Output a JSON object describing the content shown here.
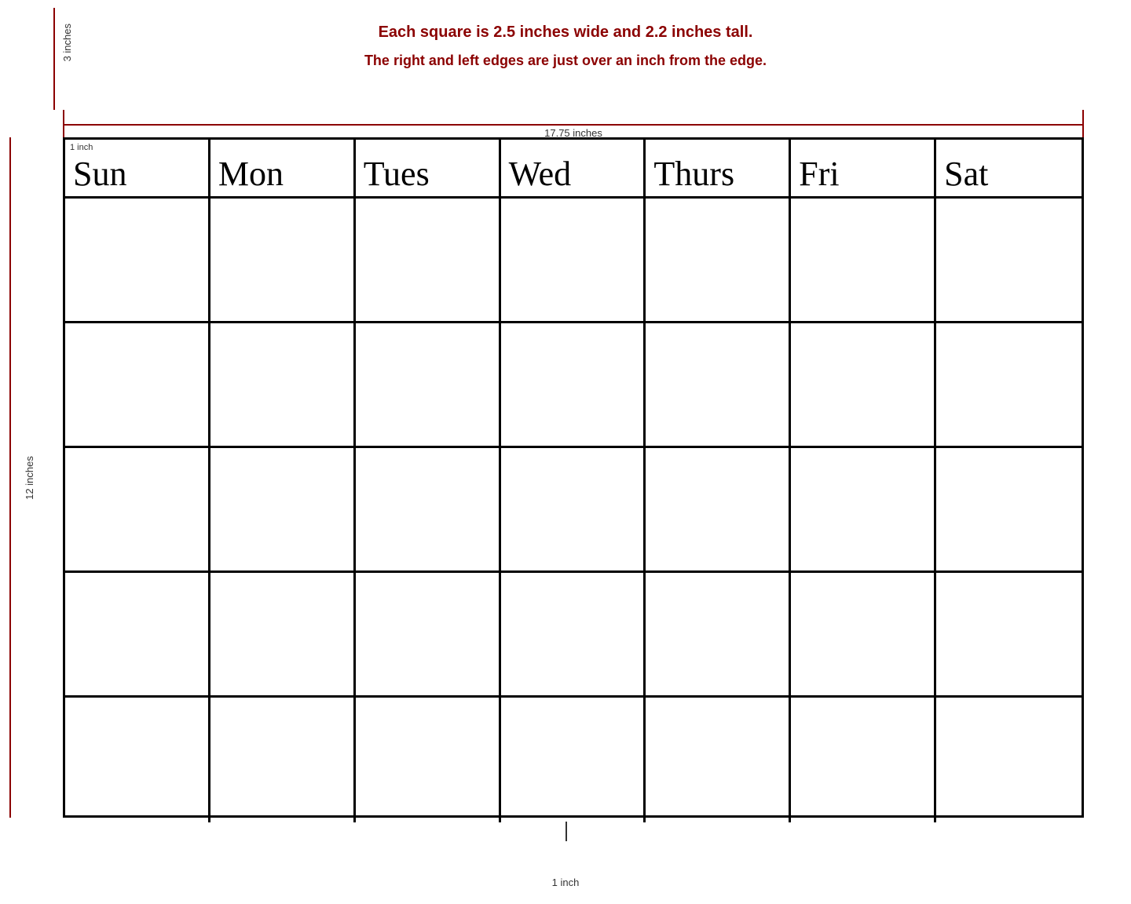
{
  "annotations": {
    "line1": "Each square is 2.5 inches wide and 2.2 inches tall.",
    "line2": "The right and left edges are just over an inch from the edge.",
    "width_label": "17.75 inches",
    "height_label": "12 inches",
    "top_height_label": "3 inches",
    "top_inch_label": "1 inch",
    "bottom_inch_label": "1 inch"
  },
  "calendar": {
    "days": [
      "Sun",
      "Mon",
      "Tues",
      "Wed",
      "Thurs",
      "Fri",
      "Sat"
    ],
    "rows": 5
  }
}
